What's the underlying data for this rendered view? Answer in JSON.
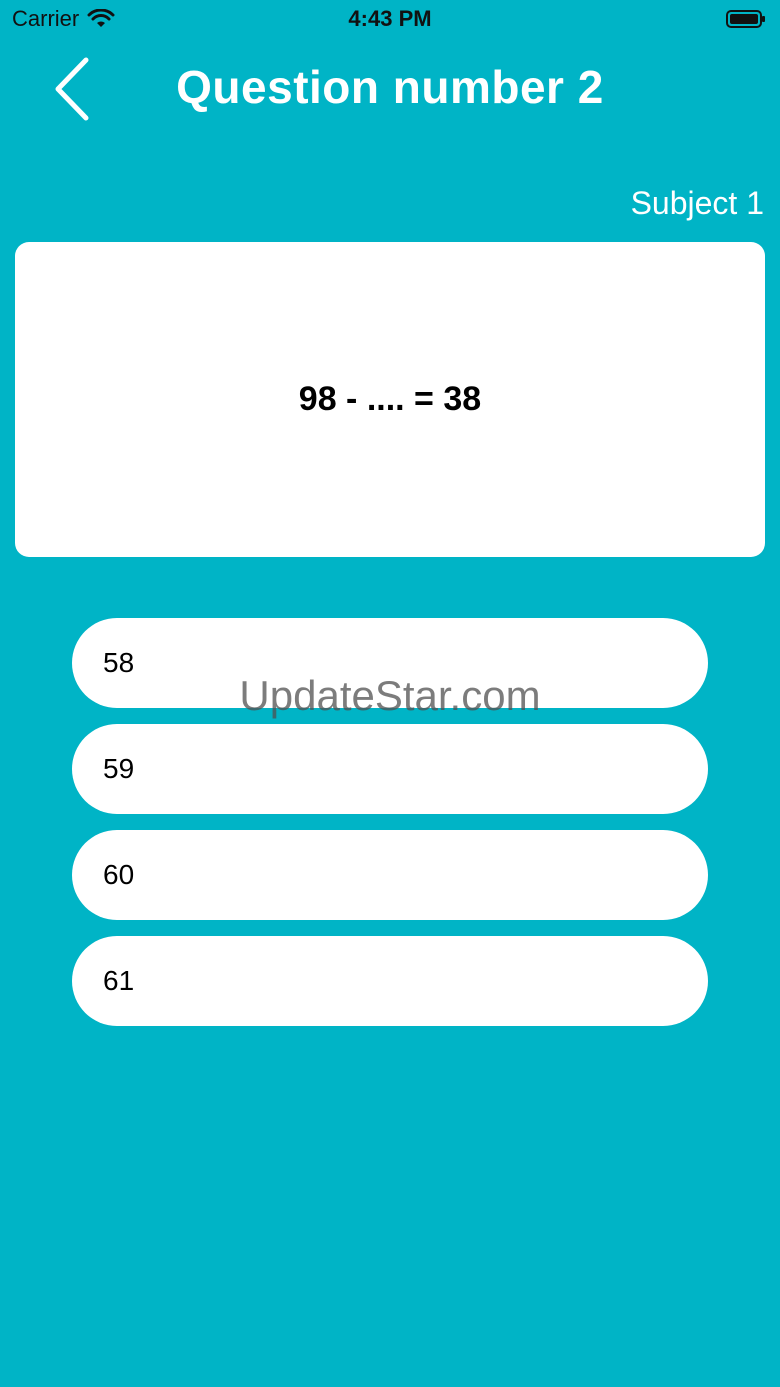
{
  "status_bar": {
    "carrier": "Carrier",
    "time": "4:43 PM",
    "wifi_icon": "wifi-icon",
    "battery_icon": "battery-icon"
  },
  "header": {
    "title": "Question number 2",
    "back_icon": "chevron-left-icon"
  },
  "subject": {
    "label": "Subject 1"
  },
  "question": {
    "text": "98 - .... = 38"
  },
  "answers": [
    {
      "label": "58"
    },
    {
      "label": "59"
    },
    {
      "label": "60"
    },
    {
      "label": "61"
    }
  ],
  "watermark": {
    "text": "UpdateStar.com"
  },
  "colors": {
    "background": "#00B4C6",
    "card": "#FFFFFF",
    "text_dark": "#000000",
    "text_light": "#FFFFFF"
  }
}
